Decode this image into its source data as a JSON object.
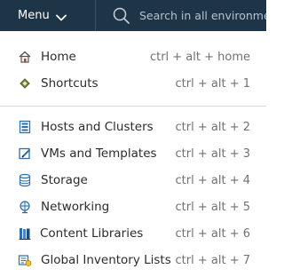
{
  "header": {
    "menu_label": "Menu",
    "search_placeholder": "Search in all environme"
  },
  "menu": {
    "items": [
      {
        "label": "Home",
        "shortcut": "ctrl + alt + home",
        "icon": "home-icon"
      },
      {
        "label": "Shortcuts",
        "shortcut": "ctrl + alt + 1",
        "icon": "shortcuts-icon"
      },
      {
        "label": "Hosts and Clusters",
        "shortcut": "ctrl + alt + 2",
        "icon": "hosts-clusters-icon"
      },
      {
        "label": "VMs and Templates",
        "shortcut": "ctrl + alt + 3",
        "icon": "vms-templates-icon"
      },
      {
        "label": "Storage",
        "shortcut": "ctrl + alt + 4",
        "icon": "storage-icon"
      },
      {
        "label": "Networking",
        "shortcut": "ctrl + alt + 5",
        "icon": "networking-icon"
      },
      {
        "label": "Content Libraries",
        "shortcut": "ctrl + alt + 6",
        "icon": "content-libraries-icon"
      },
      {
        "label": "Global Inventory Lists",
        "shortcut": "ctrl + alt + 7",
        "icon": "global-inventory-icon"
      }
    ]
  },
  "colors": {
    "header_bg": "#1d3547",
    "text": "#2b2b2b",
    "shortcut_text": "#717171",
    "icon_blue": "#2f6ea6"
  }
}
